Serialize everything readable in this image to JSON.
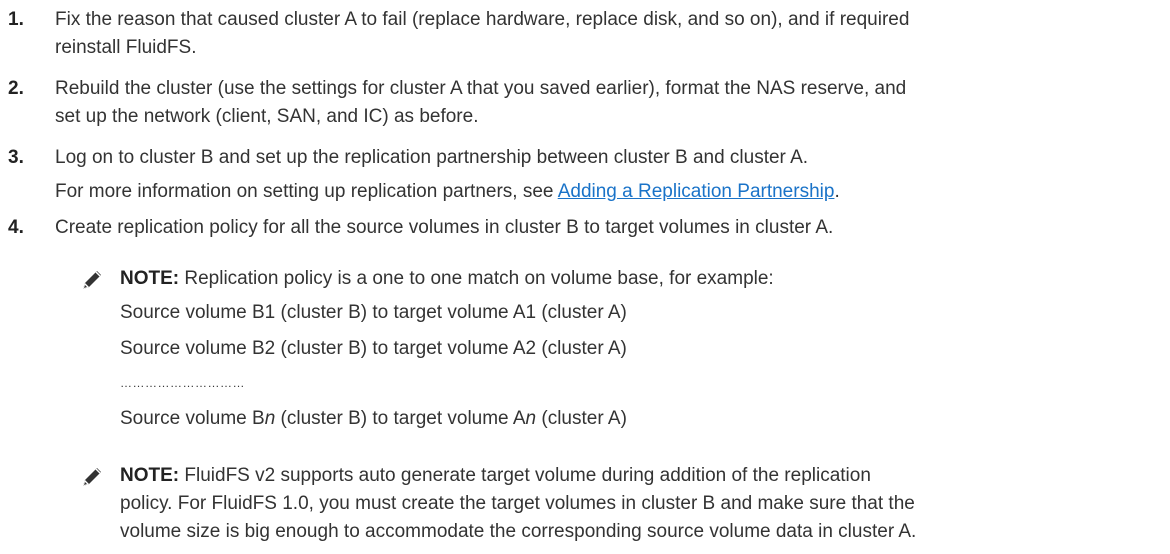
{
  "steps": [
    {
      "number": "1.",
      "lines": [
        "Fix the reason that caused cluster A to fail (replace hardware, replace disk, and so on), and if required",
        "reinstall FluidFS."
      ]
    },
    {
      "number": "2.",
      "lines": [
        "Rebuild the cluster (use the settings for cluster A that you saved earlier), format the NAS reserve, and",
        "set up the network (client, SAN, and IC) as before."
      ]
    },
    {
      "number": "3.",
      "line1": "Log on to cluster B and set up the replication partnership between cluster B and cluster A.",
      "line2_prefix": "For more information on setting up replication partners, see ",
      "link": "Adding a Replication Partnership",
      "line2_suffix": "."
    },
    {
      "number": "4.",
      "line1": "Create replication policy for all the source volumes in cluster B to target volumes in cluster A."
    }
  ],
  "note1": {
    "icon": "note-pencil-icon",
    "label": "NOTE:",
    "text": " Replication policy is a one to one match on volume base, for example:",
    "ex1": "Source volume B1 (cluster B) to target volume A1 (cluster A)",
    "ex2": "Source volume B2 (cluster B) to target volume A2 (cluster A)",
    "dots": "…………………………",
    "exn_a": "Source volume B",
    "exn_n1": "n",
    "exn_b": " (cluster B) to target volume A",
    "exn_n2": "n",
    "exn_c": " (cluster A)"
  },
  "note2": {
    "icon": "note-pencil-icon",
    "label": "NOTE:",
    "line1": " FluidFS v2 supports auto generate target volume during addition of the replication",
    "line2": "policy. For FluidFS 1.0, you must create the target volumes in cluster B and make sure that the",
    "line3": "volume size is big enough to accommodate the corresponding source volume data in cluster A."
  }
}
